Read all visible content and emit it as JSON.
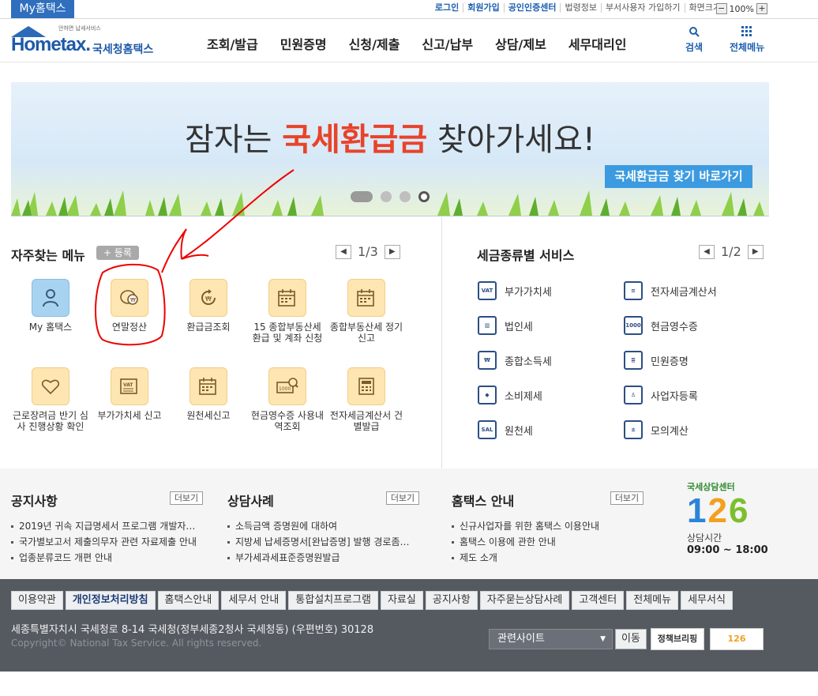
{
  "topbar": {
    "my_hometax": "My홈택스",
    "links": [
      "로그인",
      "회원가입",
      "공인인증센터",
      "법령정보",
      "부서사용자 가입하기",
      "화면크기"
    ],
    "zoom_minus": "−",
    "zoom_value": "100%",
    "zoom_plus": "+"
  },
  "header": {
    "logo_small": "안하면 납세서비스",
    "logo_main": "Hometax.",
    "logo_korean": "국세청홈택스",
    "menu": [
      "조회/발급",
      "민원증명",
      "신청/제출",
      "신고/납부",
      "상담/제보",
      "세무대리인"
    ],
    "search_label": "검색",
    "allmenu_label": "전체메뉴"
  },
  "banner": {
    "text_before": "잠자는 ",
    "text_highlight": "국세환급금",
    "text_after": " 찾아가세요!",
    "cta": "국세환급금 찾기 바로가기"
  },
  "frequent": {
    "title": "자주찾는 메뉴",
    "register": "+ 등록",
    "page": "1/3",
    "items": [
      {
        "label": "My 홈택스",
        "icon": "person-icon"
      },
      {
        "label": "연말정산",
        "icon": "coins-icon"
      },
      {
        "label": "환급금조회",
        "icon": "refund-icon"
      },
      {
        "label": "15 종합부동산세 환급 및 계좌 신청",
        "icon": "calendar-icon"
      },
      {
        "label": "종합부동산세 정기신고",
        "icon": "calendar-icon"
      },
      {
        "label": "근로장려금 반기 심사 진행상황 확인",
        "icon": "heart-icon"
      },
      {
        "label": "부가가치세 신고",
        "icon": "vat-icon"
      },
      {
        "label": "원천세신고",
        "icon": "calendar-icon"
      },
      {
        "label": "현금영수증 사용내역조회",
        "icon": "receipt-icon"
      },
      {
        "label": "전자세금계산서 건별발급",
        "icon": "calculator-icon"
      }
    ]
  },
  "taxservice": {
    "title": "세금종류별 서비스",
    "page": "1/2",
    "items": [
      {
        "label": "부가가치세",
        "icon": "VAT"
      },
      {
        "label": "전자세금계산서",
        "icon": "≡"
      },
      {
        "label": "법인세",
        "icon": "▥"
      },
      {
        "label": "현금영수증",
        "icon": "1000"
      },
      {
        "label": "종합소득세",
        "icon": "₩"
      },
      {
        "label": "민원증명",
        "icon": "≣"
      },
      {
        "label": "소비제세",
        "icon": "◆"
      },
      {
        "label": "사업자등록",
        "icon": "♙"
      },
      {
        "label": "원천세",
        "icon": "SAL"
      },
      {
        "label": "모의계산",
        "icon": "±"
      }
    ]
  },
  "boards": {
    "notice": {
      "title": "공지사항",
      "more": "더보기",
      "items": [
        "2019년 귀속 지급명세서 프로그램 개발자…",
        "국가별보고서 제출의무자 관련 자료제출 안내",
        "업종분류코드 개편 안내"
      ]
    },
    "consult": {
      "title": "상담사례",
      "more": "더보기",
      "items": [
        "소득금액 증명원에 대하여",
        "지방세 납세증명서[완납증명] 발행 경로좀…",
        "부가세과세표준증명원발급"
      ]
    },
    "guide": {
      "title": "홈택스 안내",
      "more": "더보기",
      "items": [
        "신규사업자를 위한 홈택스 이용안내",
        "홈택스 이용에 관한 안내",
        "제도 소개"
      ]
    },
    "center": {
      "title": "국세상담센터",
      "d1": "1",
      "d2": "2",
      "d3": "6",
      "hours_label": "상담시간",
      "hours": "09:00 ~ 18:00"
    }
  },
  "footer": {
    "links": [
      "이용약관",
      "개인정보처리방침",
      "홈택스안내",
      "세무서 안내",
      "통합설치프로그램",
      "자료실",
      "공지사항",
      "자주묻는상담사례",
      "고객센터",
      "전체메뉴",
      "세무서식"
    ],
    "address": "세종특별자치시 국세청로 8-14 국세청(정부세종2청사 국세청동) (우편번호) 30128",
    "copyright": "Copyright© National Tax Service. All rights reserved.",
    "related": "관련사이트",
    "go": "이동",
    "logo1": "정책브리핑",
    "logo2": "126"
  }
}
